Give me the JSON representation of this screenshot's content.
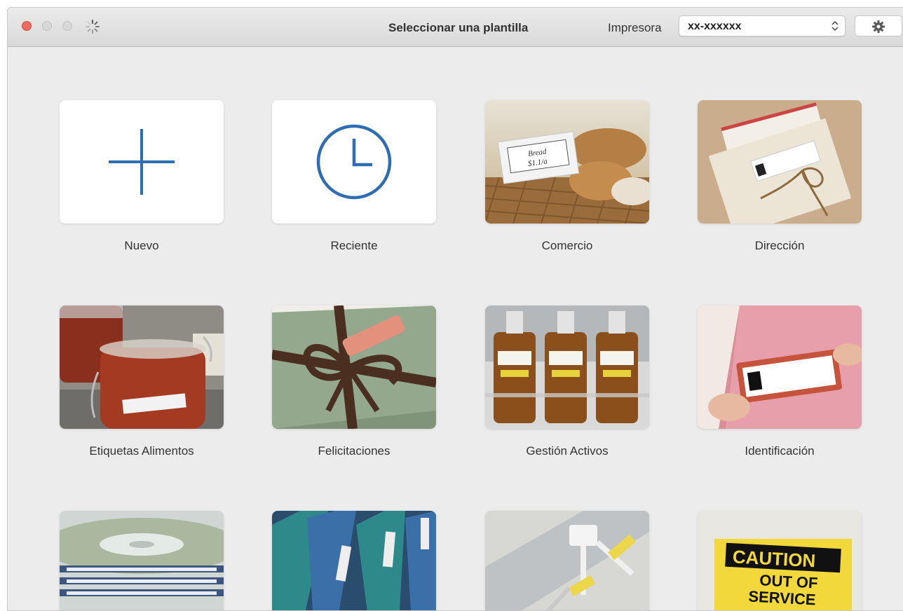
{
  "window": {
    "title": "Seleccionar una plantilla"
  },
  "toolbar": {
    "printer_label": "Impresora",
    "printer_value": "xx-xxxxxx",
    "settings_icon": "gear-icon"
  },
  "templates": [
    {
      "label": "Nuevo",
      "icon": "plus-icon"
    },
    {
      "label": "Reciente",
      "icon": "clock-icon"
    },
    {
      "label": "Comercio",
      "image": "bread-basket-price-tag",
      "tag_text": [
        "Bread",
        "$1.1/a"
      ]
    },
    {
      "label": "Dirección",
      "image": "envelopes-with-address-label"
    },
    {
      "label": "Etiquetas Alimentos",
      "image": "jam-jars"
    },
    {
      "label": "Felicitaciones",
      "image": "gift-box-with-tag"
    },
    {
      "label": "Gestión Activos",
      "image": "amber-bottles"
    },
    {
      "label": "Identificación",
      "image": "name-badge"
    },
    {
      "label": "",
      "image": "cd-stack"
    },
    {
      "label": "",
      "image": "binders"
    },
    {
      "label": "",
      "image": "cables"
    },
    {
      "label": "",
      "image": "caution-sign",
      "sign_text": [
        "CAUTION",
        "OUT OF",
        "SERVICE"
      ]
    }
  ],
  "colors": {
    "accent": "#2f6db3",
    "close": "#ee6a5e"
  }
}
